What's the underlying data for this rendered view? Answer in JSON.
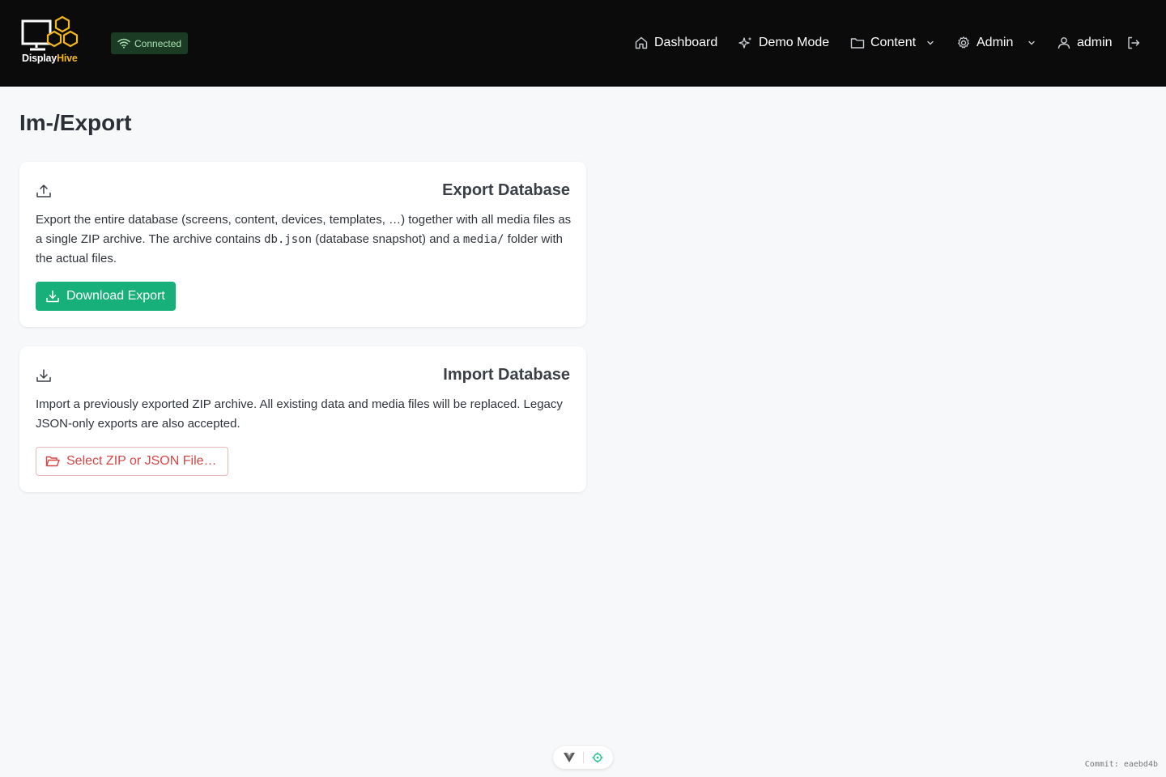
{
  "brand": {
    "name_part1": "Display",
    "name_part2": "Hive",
    "accent_color": "#f5b81c"
  },
  "connection": {
    "label": "Connected",
    "icon": "wifi-icon",
    "color": "#a7e0b0"
  },
  "nav": {
    "items": [
      {
        "label": "Dashboard",
        "icon": "home-icon"
      },
      {
        "label": "Demo Mode",
        "icon": "sparkles-icon"
      },
      {
        "label": "Content",
        "icon": "folder-icon",
        "dropdown": true
      },
      {
        "label": "Admin",
        "icon": "gear-icon",
        "dropdown": true
      }
    ],
    "user": {
      "label": "admin",
      "icon": "user-icon"
    },
    "logout_icon": "logout-icon"
  },
  "page": {
    "title": "Im-/Export"
  },
  "export_card": {
    "title": "Export Database",
    "icon": "upload-icon",
    "desc_part1": "Export the entire database (screens, content, devices, templates, …) together with all media files as a single ZIP archive. The archive contains ",
    "desc_code1": "db.json",
    "desc_part2": " (database snapshot) and a ",
    "desc_code2": "media/",
    "desc_part3": " folder with the actual files.",
    "button_label": "Download Export",
    "button_icon": "download-icon",
    "button_color": "#17b07a"
  },
  "import_card": {
    "title": "Import Database",
    "icon": "download-icon",
    "desc": "Import a previously exported ZIP archive. All existing data and media files will be replaced. Legacy JSON-only exports are also accepted.",
    "button_label": "Select ZIP or JSON File…",
    "button_icon": "folder-open-icon",
    "button_color": "#d64545"
  },
  "devtools": {
    "icons": [
      "vue-icon",
      "target-icon"
    ]
  },
  "footer": {
    "commit": "Commit: eaebd4b"
  }
}
